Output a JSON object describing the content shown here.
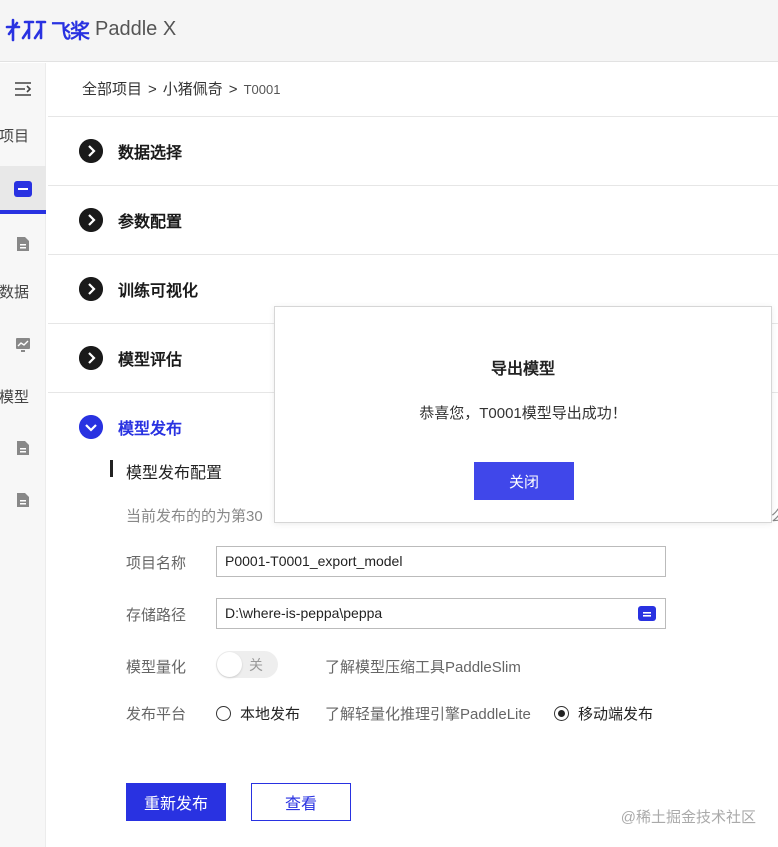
{
  "brand": {
    "logo_cn": "飞桨",
    "logo_en": "Paddle X",
    "accent": "#2932e1"
  },
  "sidebar": {
    "icons": [
      "menu-collapse-icon",
      "folder-icon",
      "document-icon",
      "chart-icon",
      "document-icon",
      "document-icon"
    ],
    "labels": [
      "项目",
      "数据",
      "模型"
    ]
  },
  "breadcrumb": {
    "items": [
      "全部项目",
      "小猪佩奇",
      "T0001"
    ],
    "separator": ">"
  },
  "sections": [
    {
      "title": "数据选择",
      "expanded": false
    },
    {
      "title": "参数配置",
      "expanded": false
    },
    {
      "title": "训练可视化",
      "expanded": false
    },
    {
      "title": "模型评估",
      "expanded": false
    },
    {
      "title": "模型发布",
      "expanded": true
    }
  ],
  "publish": {
    "subtitle": "模型发布配置",
    "info_text": "当前发布的的为第30",
    "info_tail": "么",
    "project_name_label": "项目名称",
    "project_name_value": "P0001-T0001_export_model",
    "storage_path_label": "存储路径",
    "storage_path_value": "D:\\where-is-peppa\\peppa",
    "quantize_label": "模型量化",
    "quantize_toggle_text": "关",
    "quantize_enabled": false,
    "paddleslim_link": "了解模型压缩工具PaddleSlim",
    "platform_label": "发布平台",
    "platform_options": [
      "本地发布",
      "移动端发布"
    ],
    "platform_selected": "移动端发布",
    "paddlelite_link": "了解轻量化推理引擎PaddleLite",
    "republish_button": "重新发布",
    "view_button": "查看"
  },
  "modal": {
    "title": "导出模型",
    "message": "恭喜您，T0001模型导出成功！",
    "close_button": "关闭"
  },
  "watermark": "@稀土掘金技术社区"
}
